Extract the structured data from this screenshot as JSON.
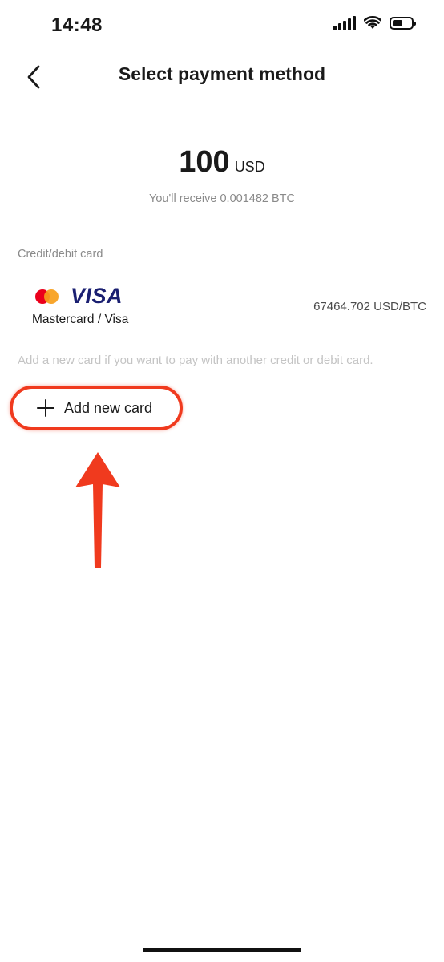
{
  "status_bar": {
    "time": "14:48"
  },
  "header": {
    "title": "Select payment method",
    "back_icon": "chevron-left-icon"
  },
  "amount": {
    "value": "100",
    "currency": "USD",
    "receive_text": "You'll receive 0.001482 BTC"
  },
  "payment_section": {
    "label": "Credit/debit card",
    "card": {
      "brand_visa": "VISA",
      "name": "Mastercard / Visa",
      "rate": "67464.702 USD/BTC"
    },
    "hint": "Add a new card if you want to pay with another credit or debit card.",
    "add_button_label": "Add new card"
  },
  "colors": {
    "annotation": "#f03a1e",
    "visa_blue": "#1a1f71",
    "mastercard_red": "#eb001b",
    "mastercard_orange": "#f79e1b"
  }
}
